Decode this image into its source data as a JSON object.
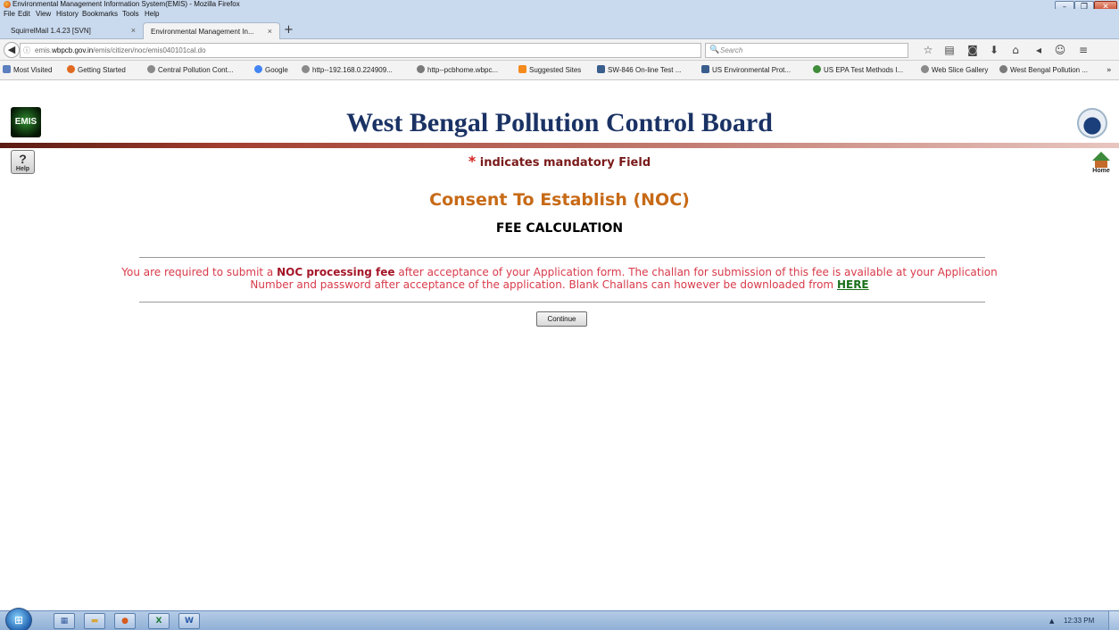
{
  "window": {
    "title": "Environmental Management Information System(EMIS) - Mozilla Firefox",
    "min_glyph": "–",
    "max_glyph": "❐",
    "close_glyph": "✕"
  },
  "menu": [
    "File",
    "Edit",
    "View",
    "History",
    "Bookmarks",
    "Tools",
    "Help"
  ],
  "tabs": [
    {
      "label": "SquirrelMail 1.4.23 [SVN]",
      "close": "×",
      "active": false
    },
    {
      "label": "Environmental Management In...",
      "close": "×",
      "active": true
    }
  ],
  "new_tab_glyph": "+",
  "nav": {
    "back_glyph": "◀",
    "info_glyph": "ⓘ",
    "url_prefix": "emis.",
    "url_domain": "wbpcb.gov.in",
    "url_path": "/emis/citizen/noc/emis040101cal.do",
    "reload_glyph": "↻",
    "search_glyph": "🔍",
    "search_placeholder": "Search",
    "toolbar_icons": [
      "star-icon",
      "reading-list-icon",
      "pocket-icon",
      "download-icon",
      "home-icon",
      "send-icon",
      "chat-icon",
      "menu-icon"
    ],
    "toolbar_glyphs": [
      "☆",
      "▤",
      "◙",
      "⬇",
      "⌂",
      "◂",
      "☺",
      "≡"
    ]
  },
  "bookmarks": [
    {
      "label": "Most Visited",
      "color": "#5b7fbf"
    },
    {
      "label": "Getting Started",
      "color": "#e06a21"
    },
    {
      "label": "Central Pollution Cont...",
      "color": "#8a8a8a"
    },
    {
      "label": "Google",
      "color": "#4285f4"
    },
    {
      "label": "http--192.168.0.224909...",
      "color": "#8a8a8a"
    },
    {
      "label": "http--pcbhome.wbpc...",
      "color": "#7a7a7a"
    },
    {
      "label": "Suggested Sites",
      "color": "#f48a1c"
    },
    {
      "label": "SW-846 On-line Test ...",
      "color": "#3a5e8c"
    },
    {
      "label": "US Environmental Prot...",
      "color": "#3a5e8c"
    },
    {
      "label": "US EPA Test Methods I...",
      "color": "#3f8c3a"
    },
    {
      "label": "Web Slice Gallery",
      "color": "#8a8a8a"
    },
    {
      "label": "West Bengal Pollution ...",
      "color": "#7a7a7a"
    }
  ],
  "bookmarks_more_glyph": "»",
  "page": {
    "emis_logo_text": "EMIS",
    "site_title": "West Bengal Pollution Control Board",
    "help_glyph": "?",
    "help_label": "Help",
    "home_label": "Home",
    "mandatory_star": "*",
    "mandatory_text": "indicates mandatory Field",
    "consent_title": "Consent To Establish (NOC)",
    "fee_title": "FEE CALCULATION",
    "notice_pre": "You are required to submit a ",
    "notice_strong": "NOC processing fee",
    "notice_post": " after acceptance of your Application form. The challan for submission of this fee is available at your Application Number and password after acceptance of the application. Blank Challans can however be downloaded from ",
    "notice_link": "HERE",
    "continue_label": "Continue"
  },
  "taskbar": {
    "start_glyph": "⊞",
    "items": [
      {
        "name": "show-desktop-task",
        "glyph": "▦",
        "color": "#3a5fa0"
      },
      {
        "name": "explorer-task",
        "glyph": "▬",
        "color": "#d8a63a"
      },
      {
        "name": "firefox-task",
        "glyph": "●",
        "color": "#d85a1c"
      },
      {
        "name": "excel-task",
        "glyph": "X",
        "color": "#1f7a3a"
      },
      {
        "name": "word-task",
        "glyph": "W",
        "color": "#2b5aa8"
      }
    ],
    "tray_arrow": "▲",
    "clock": "12:33 PM"
  }
}
